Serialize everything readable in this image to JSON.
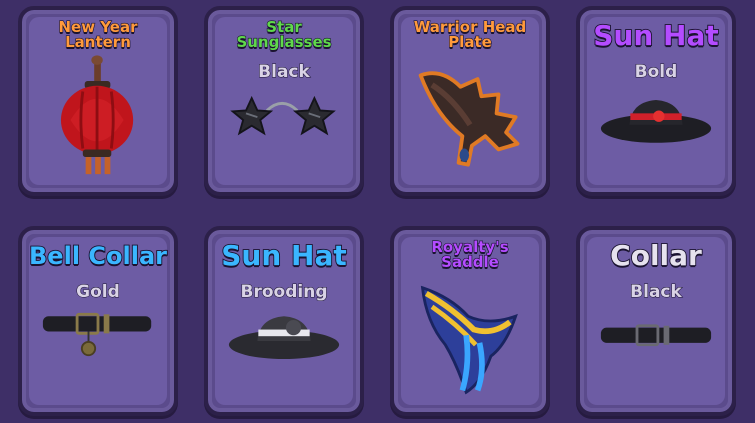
{
  "items": [
    {
      "name": "New Year\nLantern",
      "variant": "",
      "name_color": "#ff9a3c",
      "icon": "lantern-icon"
    },
    {
      "name": "Star\nSunglasses",
      "variant": "Black",
      "name_color": "#5fd84b",
      "icon": "star-sunglasses-icon"
    },
    {
      "name": "Warrior Head\nPlate",
      "variant": "",
      "name_color": "#ff9a3c",
      "icon": "warrior-head-plate-icon"
    },
    {
      "name": "Sun Hat",
      "variant": "Bold",
      "name_color": "#b44cff",
      "icon": "sun-hat-icon"
    },
    {
      "name": "Bell Collar",
      "variant": "Gold",
      "name_color": "#3ab6ff",
      "icon": "bell-collar-icon"
    },
    {
      "name": "Sun Hat",
      "variant": "Brooding",
      "name_color": "#3ab6ff",
      "icon": "sun-hat-icon"
    },
    {
      "name": "Royalty's\nSaddle",
      "variant": "",
      "name_color": "#b44cff",
      "icon": "saddle-icon"
    },
    {
      "name": "Collar",
      "variant": "Black",
      "name_color": "#e6e2ee",
      "icon": "collar-icon"
    }
  ]
}
